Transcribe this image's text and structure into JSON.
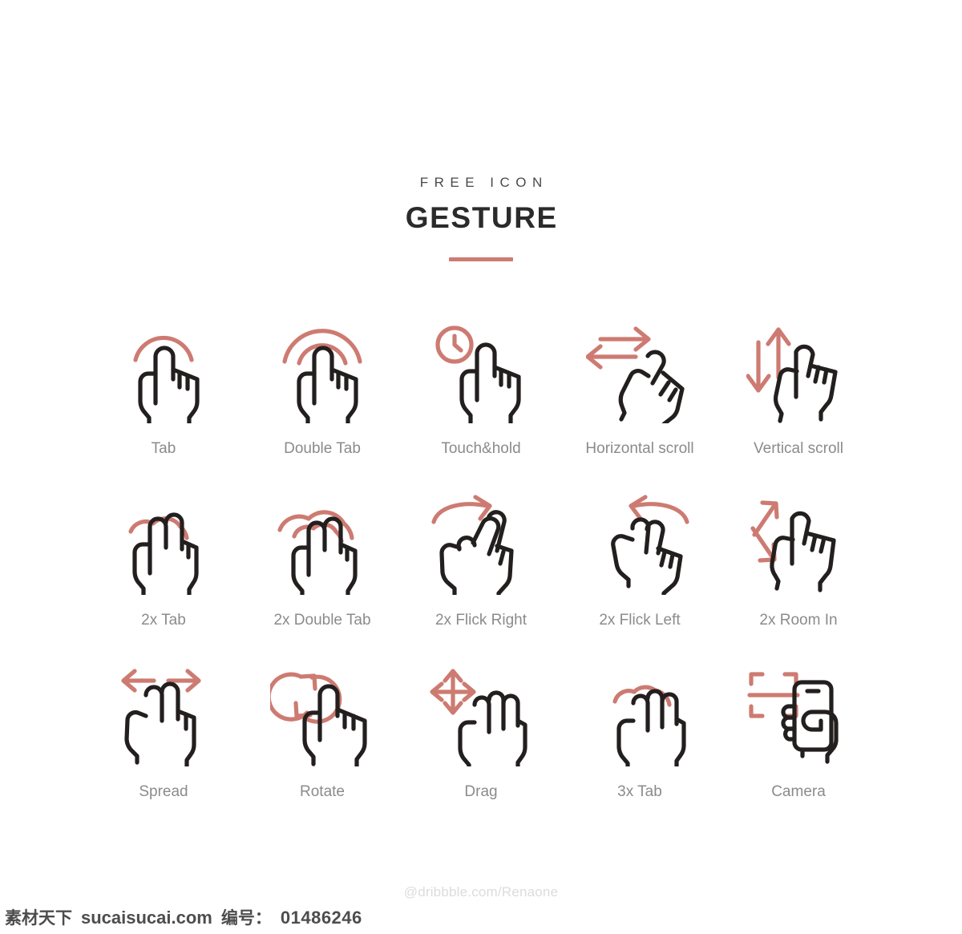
{
  "header": {
    "eyebrow": "FREE ICON",
    "title": "GESTURE"
  },
  "colors": {
    "accent": "#cd7b72",
    "icon_dark": "#231f1e",
    "label_grey": "#8b8b8b",
    "title_dark": "#2b2b2b",
    "credit_grey": "#dcdcdc",
    "background": "#ffffff"
  },
  "icons": [
    {
      "label": "Tab",
      "icon": "one-finger-tap-icon"
    },
    {
      "label": "Double Tab",
      "icon": "one-finger-double-tap-icon"
    },
    {
      "label": "Touch&hold",
      "icon": "one-finger-touch-hold-clock-icon"
    },
    {
      "label": "Horizontal scroll",
      "icon": "one-finger-horizontal-scroll-icon"
    },
    {
      "label": "Vertical scroll",
      "icon": "one-finger-vertical-scroll-icon"
    },
    {
      "label": "2x Tab",
      "icon": "two-finger-tap-icon"
    },
    {
      "label": "2x Double Tab",
      "icon": "two-finger-double-tap-icon"
    },
    {
      "label": "2x Flick Right",
      "icon": "two-finger-flick-right-icon"
    },
    {
      "label": "2x Flick Left",
      "icon": "two-finger-flick-left-icon"
    },
    {
      "label": "2x Room In",
      "icon": "two-finger-zoom-in-icon"
    },
    {
      "label": "Spread",
      "icon": "two-finger-spread-icon"
    },
    {
      "label": "Rotate",
      "icon": "one-finger-rotate-icon"
    },
    {
      "label": "Drag",
      "icon": "three-finger-drag-icon"
    },
    {
      "label": "3x Tab",
      "icon": "three-finger-tap-icon"
    },
    {
      "label": "Camera",
      "icon": "camera-phone-scan-icon"
    }
  ],
  "credit": "@dribbble.com/Renaone",
  "watermark": {
    "site_cn": "素材天下",
    "site": "sucaisucai.com",
    "number_label": "编号：",
    "number": "01486246"
  }
}
